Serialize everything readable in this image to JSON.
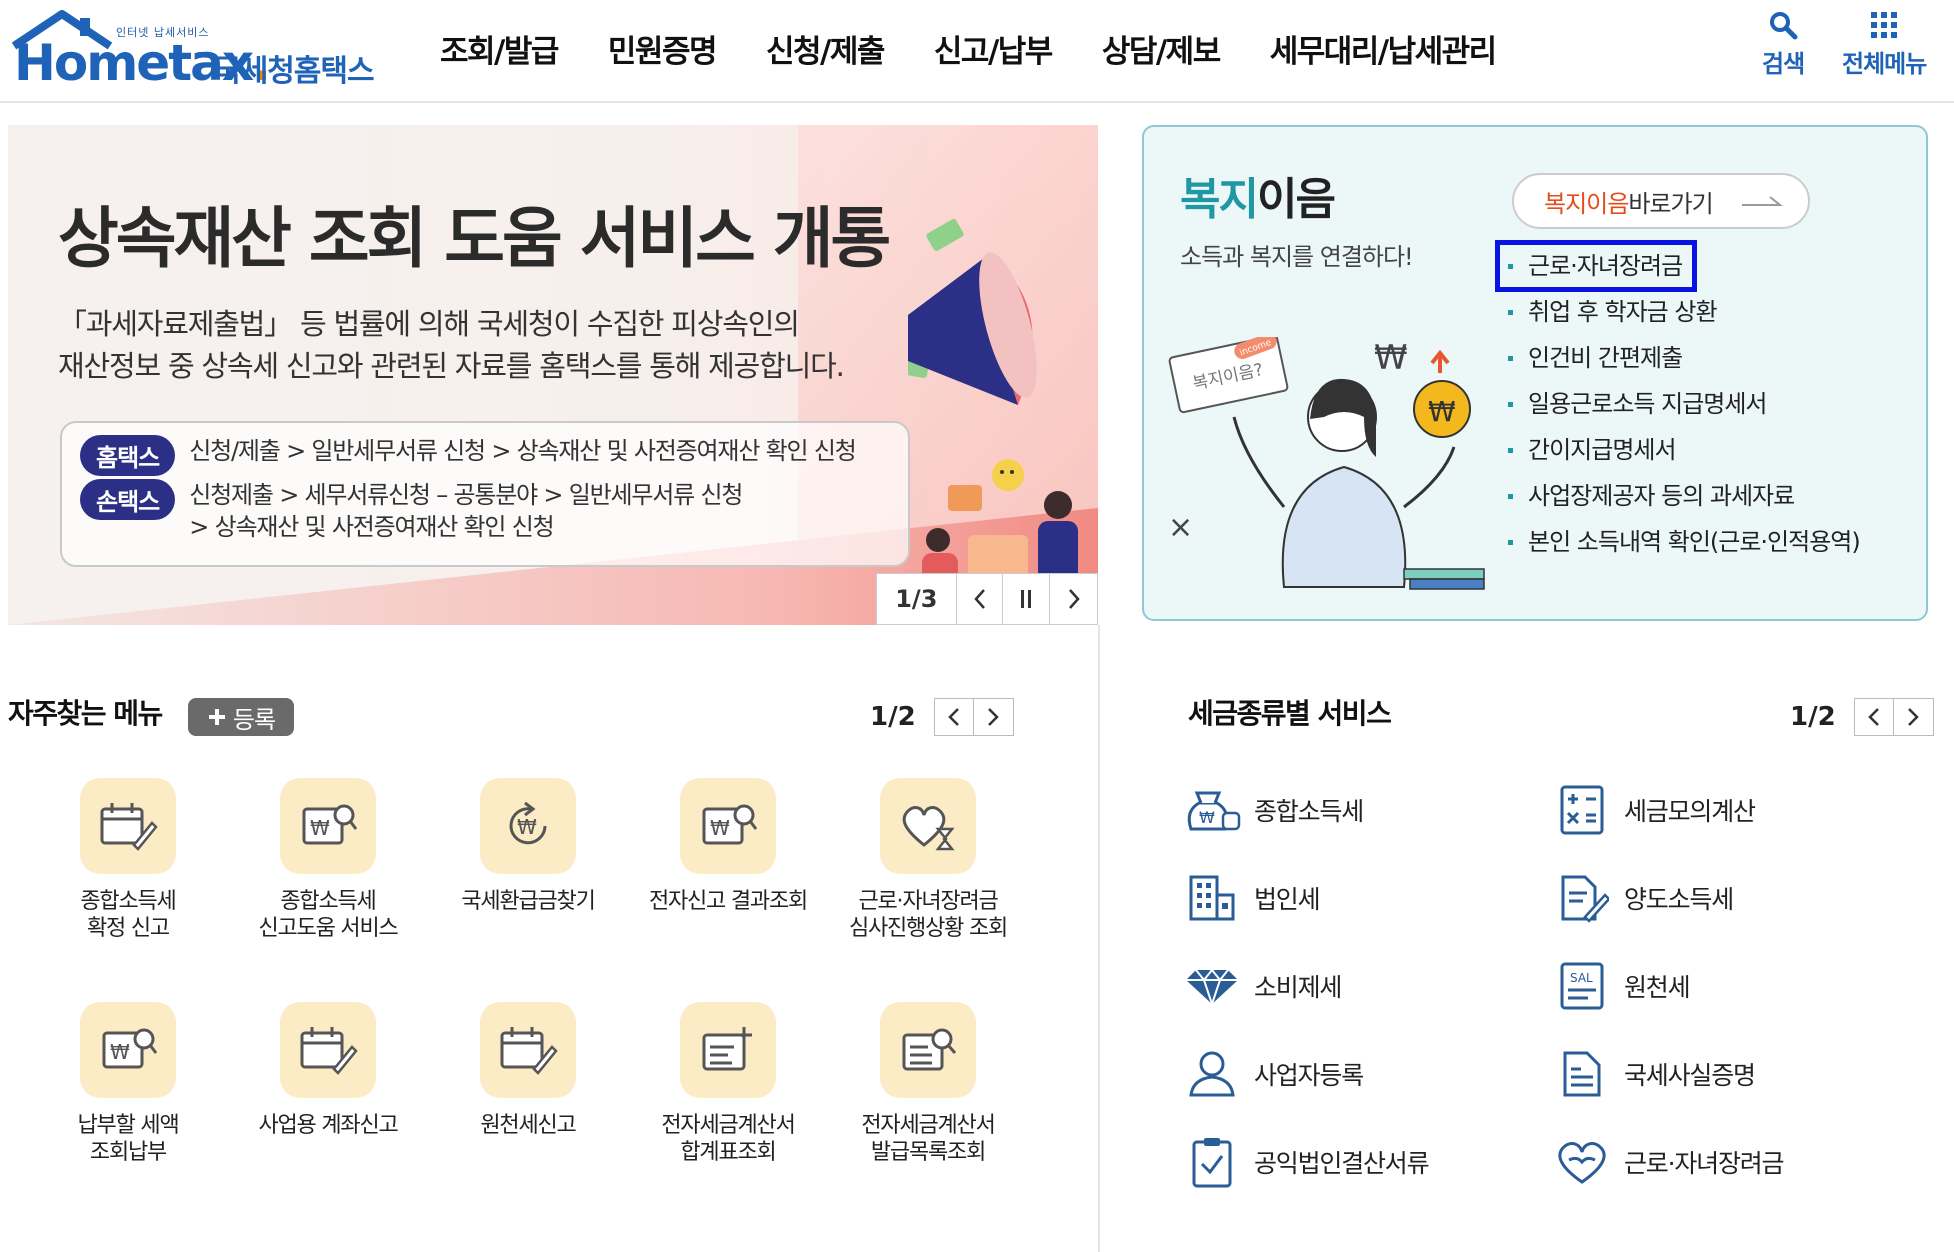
{
  "header": {
    "logo_tiny": "인터넷 납세서비스",
    "logo_home": "Hom",
    "logo_e": "e",
    "logo_tax": "tax",
    "logo_dot": ".",
    "logo_korean": "국세청홈택스",
    "nav": [
      "조회/발급",
      "민원증명",
      "신청/제출",
      "신고/납부",
      "상담/제보",
      "세무대리/납세관리"
    ],
    "search_label": "검색",
    "menu_label": "전체메뉴",
    "accent_color": "#1e63b8"
  },
  "hero": {
    "title": "상속재산 조회 도움 서비스 개통",
    "desc_line1": "「과세자료제출법」 등 법률에 의해 국세청이 수집한 피상속인의",
    "desc_line2": "재산정보 중 상속세 신고와 관련된 자료를 홈택스를 통해 제공합니다.",
    "path1_badge": "홈택스",
    "path1_text": "신청/제출 > 일반세무서류 신청 > 상속재산 및 사전증여재산 확인 신청",
    "path2_badge": "손택스",
    "path2_text1": "신청제출 > 세무서류신청 – 공통분야 > 일반세무서류 신청",
    "path2_text2": "> 상속재산 및 사전증여재산 확인 신청",
    "slide_counter": "1/3",
    "badge_color": "#2c2f86"
  },
  "welfare": {
    "title_hl": "복지",
    "title_rest": "이음",
    "subtitle": "소득과 복지를 연결하다!",
    "go_red": "복지이음",
    "go_rest": " 바로가기",
    "illus_sign": "복지이음?",
    "illus_income": "income",
    "illus_employ": "employ",
    "items": [
      "근로·자녀장려금",
      "취업 후 학자금 상환",
      "인건비 간편제출",
      "일용근로소득 지급명세서",
      "간이지급명세서",
      "사업장제공자 등의 과세자료",
      "본인 소득내역 확인(근로·인적용역)"
    ],
    "selected_index": 0,
    "accent_color": "#1f98a4"
  },
  "frequent": {
    "title": "자주찾는 메뉴",
    "register_label": "등록",
    "page": "1/2",
    "items": [
      {
        "label": "종합소득세\n확정 신고",
        "icon": "calendar-pen-icon"
      },
      {
        "label": "종합소득세\n신고도움 서비스",
        "icon": "won-doc-search-icon"
      },
      {
        "label": "국세환급금찾기",
        "icon": "won-refresh-icon"
      },
      {
        "label": "전자신고 결과조회",
        "icon": "won-doc-search-icon"
      },
      {
        "label": "근로·자녀장려금\n심사진행상황 조회",
        "icon": "heart-hourglass-icon"
      },
      {
        "label": "납부할 세액\n조회납부",
        "icon": "won-doc-search-icon"
      },
      {
        "label": "사업용 계좌신고",
        "icon": "calendar-pen-icon"
      },
      {
        "label": "원천세신고",
        "icon": "calendar-pen-icon"
      },
      {
        "label": "전자세금계산서\n합계표조회",
        "icon": "receipt-plus-icon"
      },
      {
        "label": "전자세금계산서\n발급목록조회",
        "icon": "receipt-search-icon"
      }
    ]
  },
  "tax_services": {
    "title": "세금종류별 서비스",
    "page": "1/2",
    "items": [
      {
        "label": "종합소득세",
        "icon": "money-bag-icon"
      },
      {
        "label": "세금모의계산",
        "icon": "calculator-icon"
      },
      {
        "label": "법인세",
        "icon": "building-icon"
      },
      {
        "label": "양도소득세",
        "icon": "doc-sign-icon"
      },
      {
        "label": "소비제세",
        "icon": "diamond-icon"
      },
      {
        "label": "원천세",
        "icon": "sal-doc-icon"
      },
      {
        "label": "사업자등록",
        "icon": "person-icon"
      },
      {
        "label": "국세사실증명",
        "icon": "document-icon"
      },
      {
        "label": "공익법인결산서류",
        "icon": "clipboard-check-icon"
      },
      {
        "label": "근로·자녀장려금",
        "icon": "heart-hand-icon"
      }
    ],
    "icon_color": "#2a5c96"
  }
}
